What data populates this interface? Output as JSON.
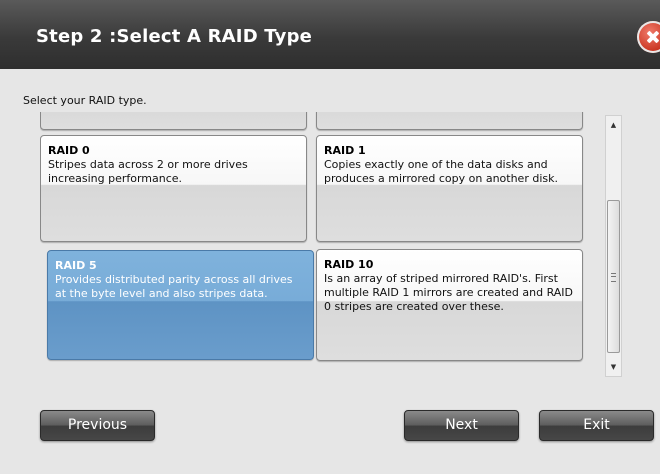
{
  "dialog": {
    "title": "Step 2 :Select A RAID Type",
    "prompt": "Select your RAID type."
  },
  "raid_options": [
    {
      "name": "RAID 0",
      "description": "Stripes data across 2 or more drives increasing performance.",
      "selected": false
    },
    {
      "name": "RAID 1",
      "description": "Copies exactly one of the data disks and produces a mirrored copy on another disk.",
      "selected": false
    },
    {
      "name": "RAID 5",
      "description": "Provides distributed parity across all drives at the byte level and also stripes data.",
      "selected": true
    },
    {
      "name": "RAID 10",
      "description": "Is an array of striped mirrored RAID's. First multiple RAID 1 mirrors are created and RAID 0 stripes are created over these.",
      "selected": false
    }
  ],
  "buttons": {
    "previous": "Previous",
    "next": "Next",
    "exit": "Exit"
  },
  "icons": {
    "close": "close-icon",
    "scroll_up": "arrow-up-icon",
    "scroll_down": "arrow-down-icon"
  },
  "colors": {
    "title_bar": "#3a3a3a",
    "selected_card": "#78acd8",
    "close_button": "#d23c2a"
  }
}
